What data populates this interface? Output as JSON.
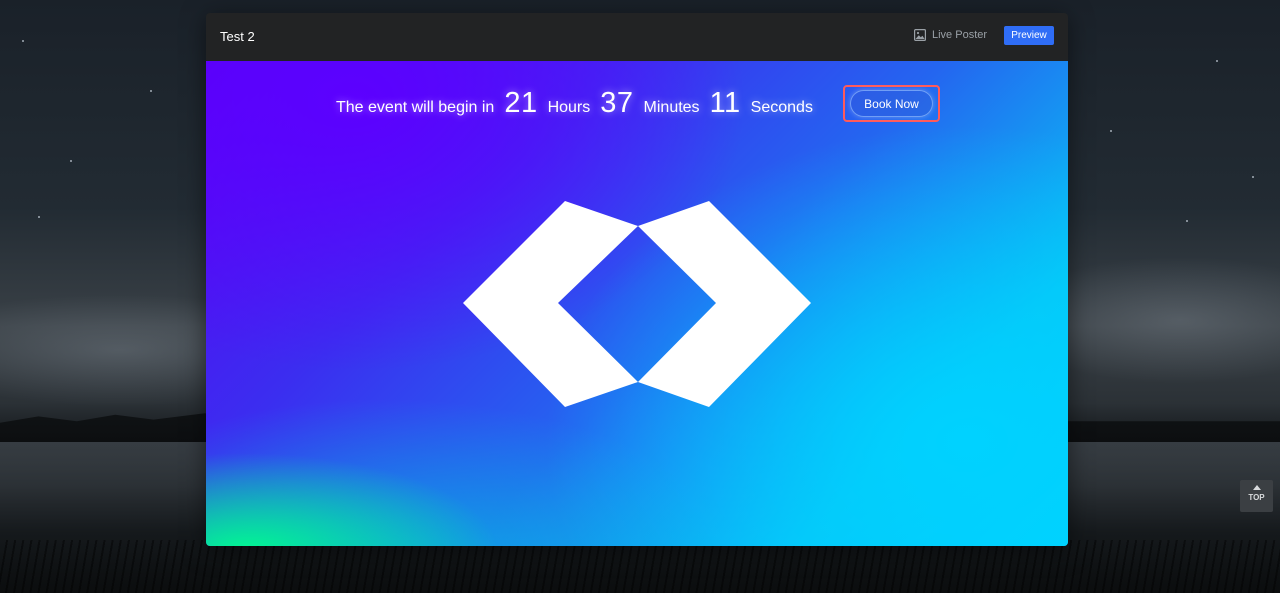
{
  "card": {
    "title": "Test 2",
    "live_poster_label": "Live Poster",
    "preview_label": "Preview"
  },
  "countdown": {
    "intro": "The event will begin in",
    "hours": "21",
    "hours_label": "Hours",
    "minutes": "37",
    "minutes_label": "Minutes",
    "seconds": "11",
    "seconds_label": "Seconds"
  },
  "book_now_label": "Book Now",
  "top_button_label": "TOP",
  "icons": {
    "live_poster": "image-icon",
    "logo": "diamond-logo",
    "top": "arrow-up-icon"
  },
  "colors": {
    "preview_button": "#2f6df6",
    "highlight_border": "#ff5a5a",
    "header_bg": "#222324",
    "stage_purple": "#5a00f5",
    "stage_cyan": "#00d4ff",
    "stage_green": "#00ff8c"
  }
}
